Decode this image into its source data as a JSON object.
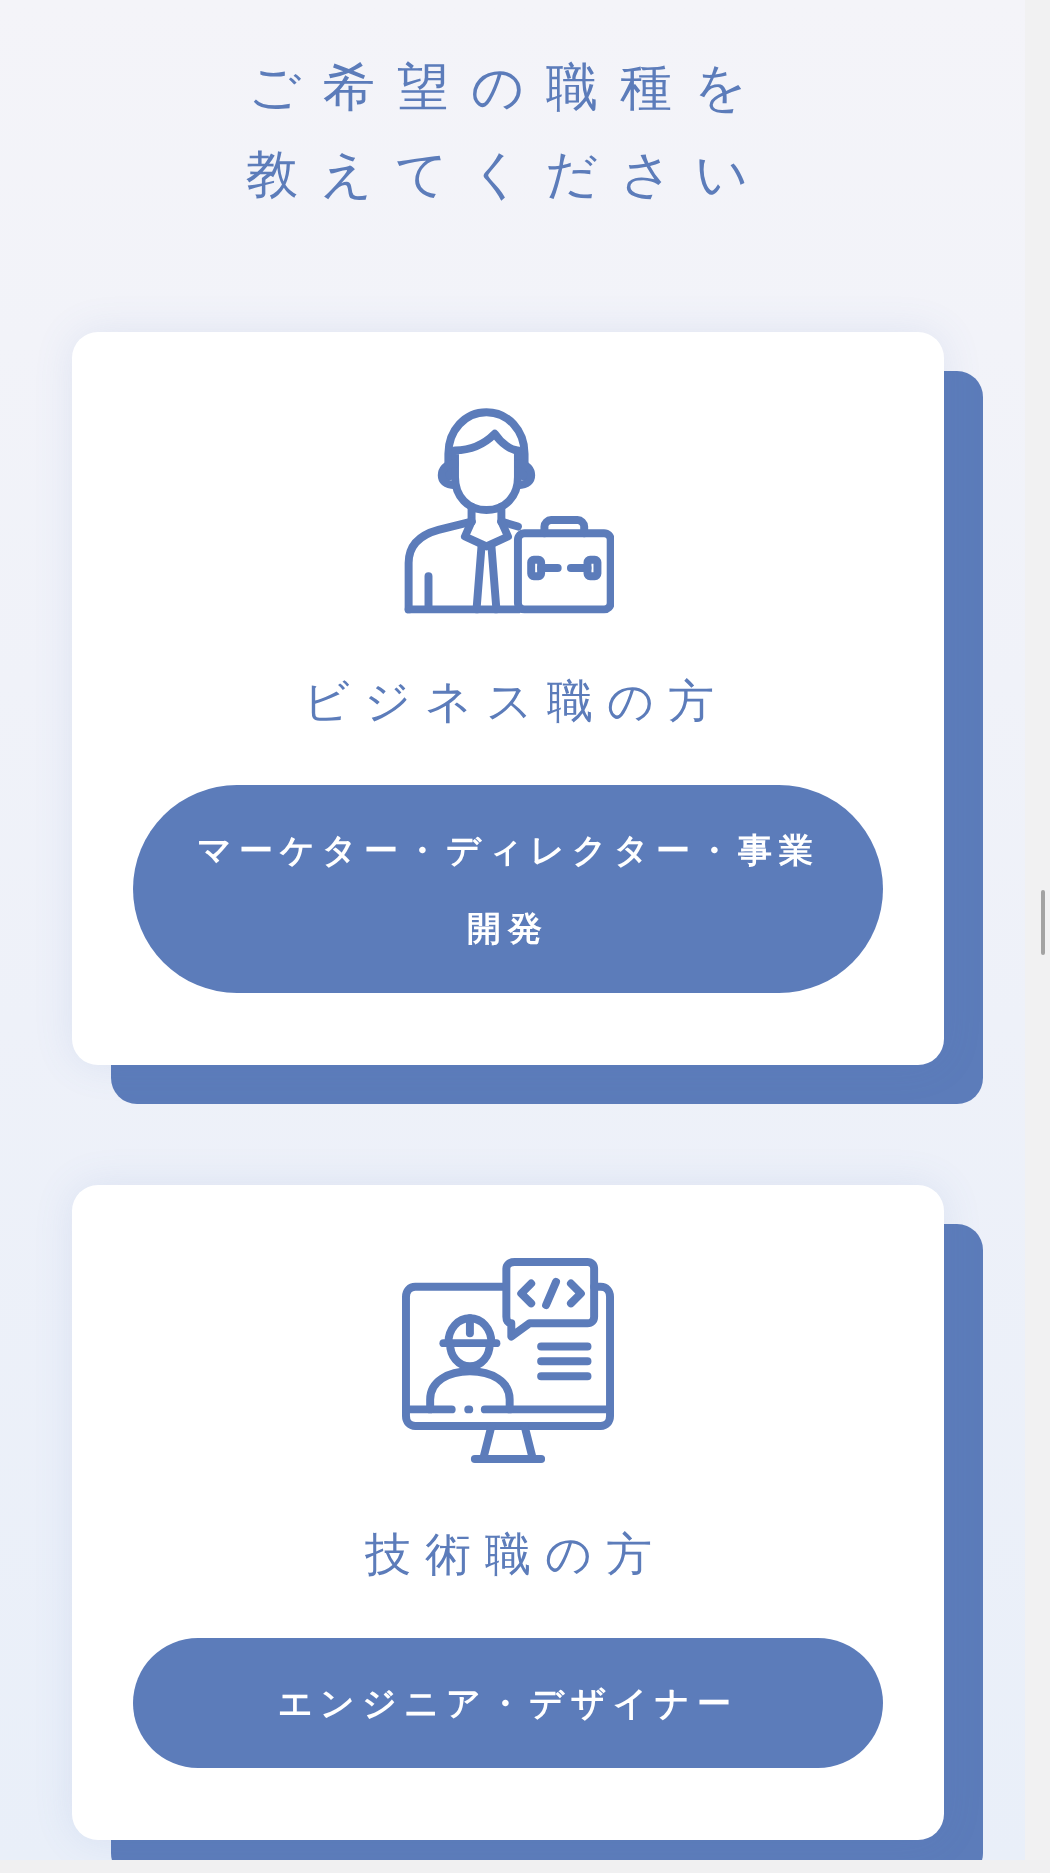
{
  "heading": "ご希望の職種を教えてください",
  "cards": [
    {
      "kind": "business",
      "title": "ビジネス職の方",
      "button": "マーケター・ディレクター・事業開発"
    },
    {
      "kind": "engineer",
      "title": "技術職の方",
      "button": "エンジニア・デザイナー"
    }
  ]
}
